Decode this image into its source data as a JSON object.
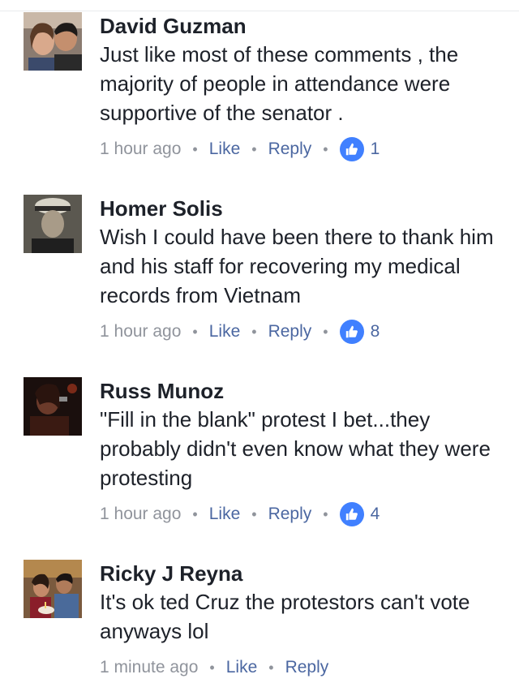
{
  "colors": {
    "author": "#1d2129",
    "text": "#1d2129",
    "meta": "#90949c",
    "action": "#4b67a1",
    "like_badge": "#4080ff"
  },
  "comments": [
    {
      "author": "David Guzman",
      "text": "Just like most of these comments , the majority of  people in attendance were supportive of the senator .",
      "time": "1 hour ago",
      "like_label": "Like",
      "reply_label": "Reply",
      "like_count": "1",
      "avatar_icon": "avatar-photo"
    },
    {
      "author": "Homer Solis",
      "text": "Wish I could have been there to thank him and his staff for recovering my medical records from Vietnam",
      "time": "1 hour ago",
      "like_label": "Like",
      "reply_label": "Reply",
      "like_count": "8",
      "avatar_icon": "avatar-photo"
    },
    {
      "author": "Russ Munoz",
      "text": "\"Fill in the blank\" protest I bet...they probably didn't even know what they were protesting",
      "time": "1 hour ago",
      "like_label": "Like",
      "reply_label": "Reply",
      "like_count": "4",
      "avatar_icon": "avatar-photo"
    },
    {
      "author": "Ricky J Reyna",
      "text": "It's ok ted Cruz the protestors can't vote anyways lol",
      "time": "1 minute ago",
      "like_label": "Like",
      "reply_label": "Reply",
      "avatar_icon": "avatar-photo"
    }
  ]
}
